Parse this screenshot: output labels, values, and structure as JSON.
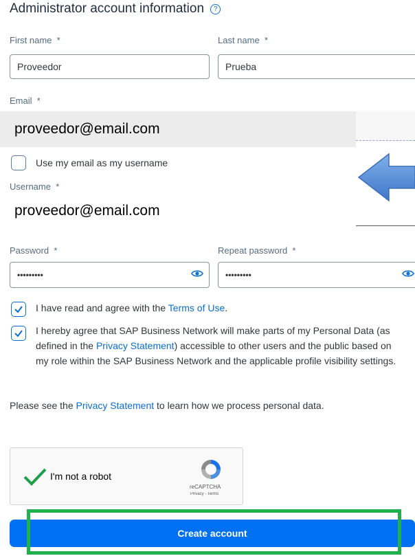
{
  "section": {
    "title": "Administrator account information",
    "help_icon": "help-circle-icon"
  },
  "form": {
    "first_name_label": "First name",
    "first_name_value": "Proveedor",
    "last_name_label": "Last name",
    "last_name_value": "Prueba",
    "email_label": "Email",
    "email_value": "proveedor@email.com",
    "use_email_label": "Use my email as my username",
    "username_label": "Username",
    "username_value": "proveedor@email.com",
    "password_label": "Password",
    "password_value": "•••••••••",
    "repeat_password_label": "Repeat password",
    "repeat_password_value": "•••••••••",
    "required_mark": "*"
  },
  "terms": {
    "prefix": "I have read and agree with the ",
    "terms_link": "Terms of Use",
    "suffix": "."
  },
  "privacy_consent": {
    "part1": "I hereby agree that SAP Business Network will make parts of my Personal Data (as defined in the ",
    "link": "Privacy Statement",
    "part2": ") accessible to other users and the public based on my role within the SAP Business Network and the applicable profile visibility settings."
  },
  "privacy_note": {
    "prefix": "Please see the ",
    "link": "Privacy Statement",
    "suffix": " to learn how we process personal data."
  },
  "captcha": {
    "label": "I'm not a robot",
    "brand": "reCAPTCHA",
    "footer": "Privacy - Terms"
  },
  "actions": {
    "create_account": "Create account"
  },
  "colors": {
    "accent": "#0a6ed1",
    "button": "#0070f2",
    "highlight_box": "#21b04b",
    "arrow": "#5b8fd9"
  }
}
